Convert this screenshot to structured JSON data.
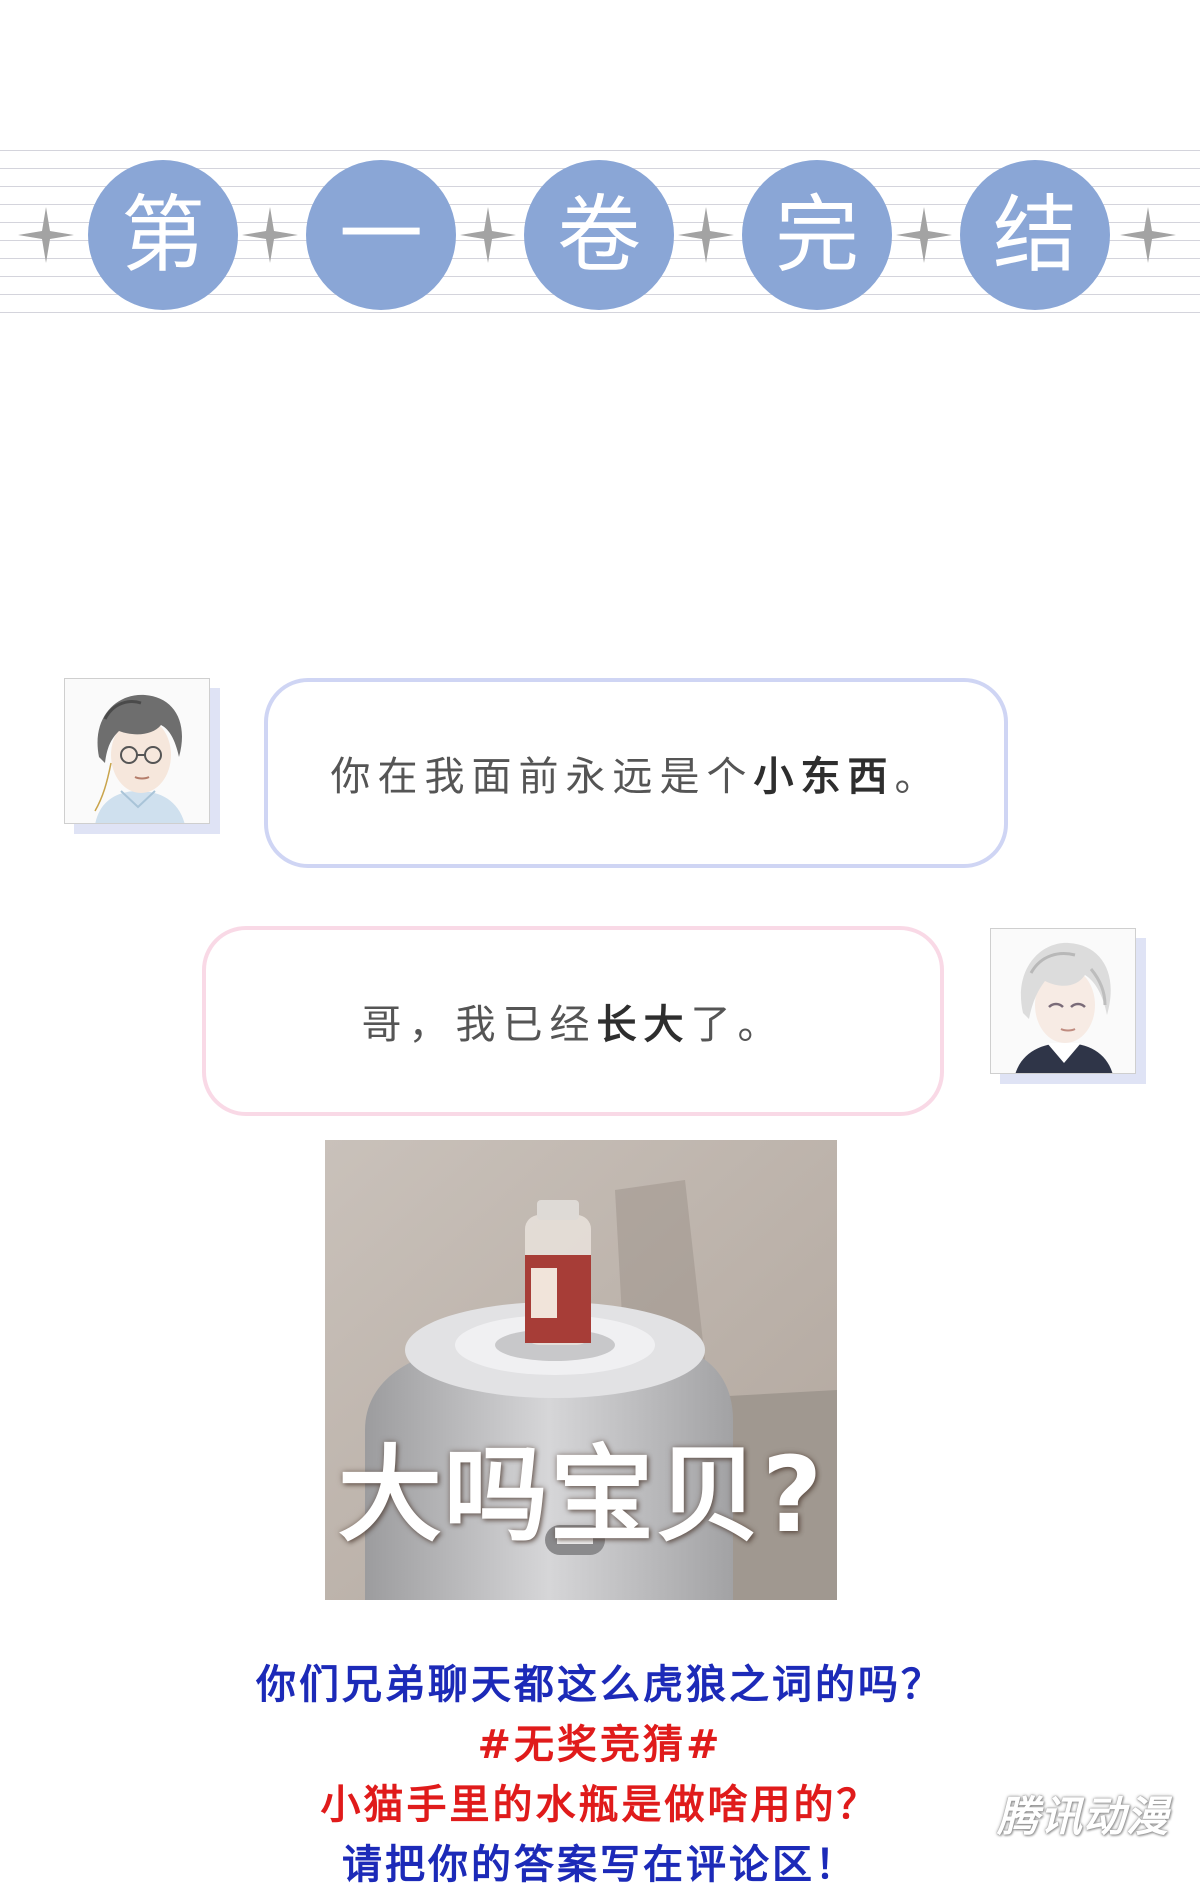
{
  "banner": {
    "chars": [
      "第",
      "一",
      "卷",
      "完",
      "结"
    ],
    "circle_color": "#8aa6d6",
    "star_color": "#a3a3a3"
  },
  "dialogue": [
    {
      "speaker": "elder-brother",
      "text_before": "你在我面前永远是个",
      "text_bold": "小东西",
      "text_after": "。",
      "border_color": "#cfd5f4"
    },
    {
      "speaker": "younger-brother",
      "text_before": "哥，我已经",
      "text_bold": "长大",
      "text_after": "了。",
      "border_color": "#f9d9e6"
    }
  ],
  "meme": {
    "caption": "大吗宝贝?"
  },
  "notes": {
    "line1": "你们兄弟聊天都这么虎狼之词的吗？",
    "line2": "#无奖竞猜#",
    "line3": "小猫手里的水瓶是做啥用的？",
    "line4": "请把你的答案写在评论区！"
  },
  "watermark": "腾讯动漫",
  "colors": {
    "blue_text": "#1c2ab8",
    "red_text": "#e01b1b"
  }
}
